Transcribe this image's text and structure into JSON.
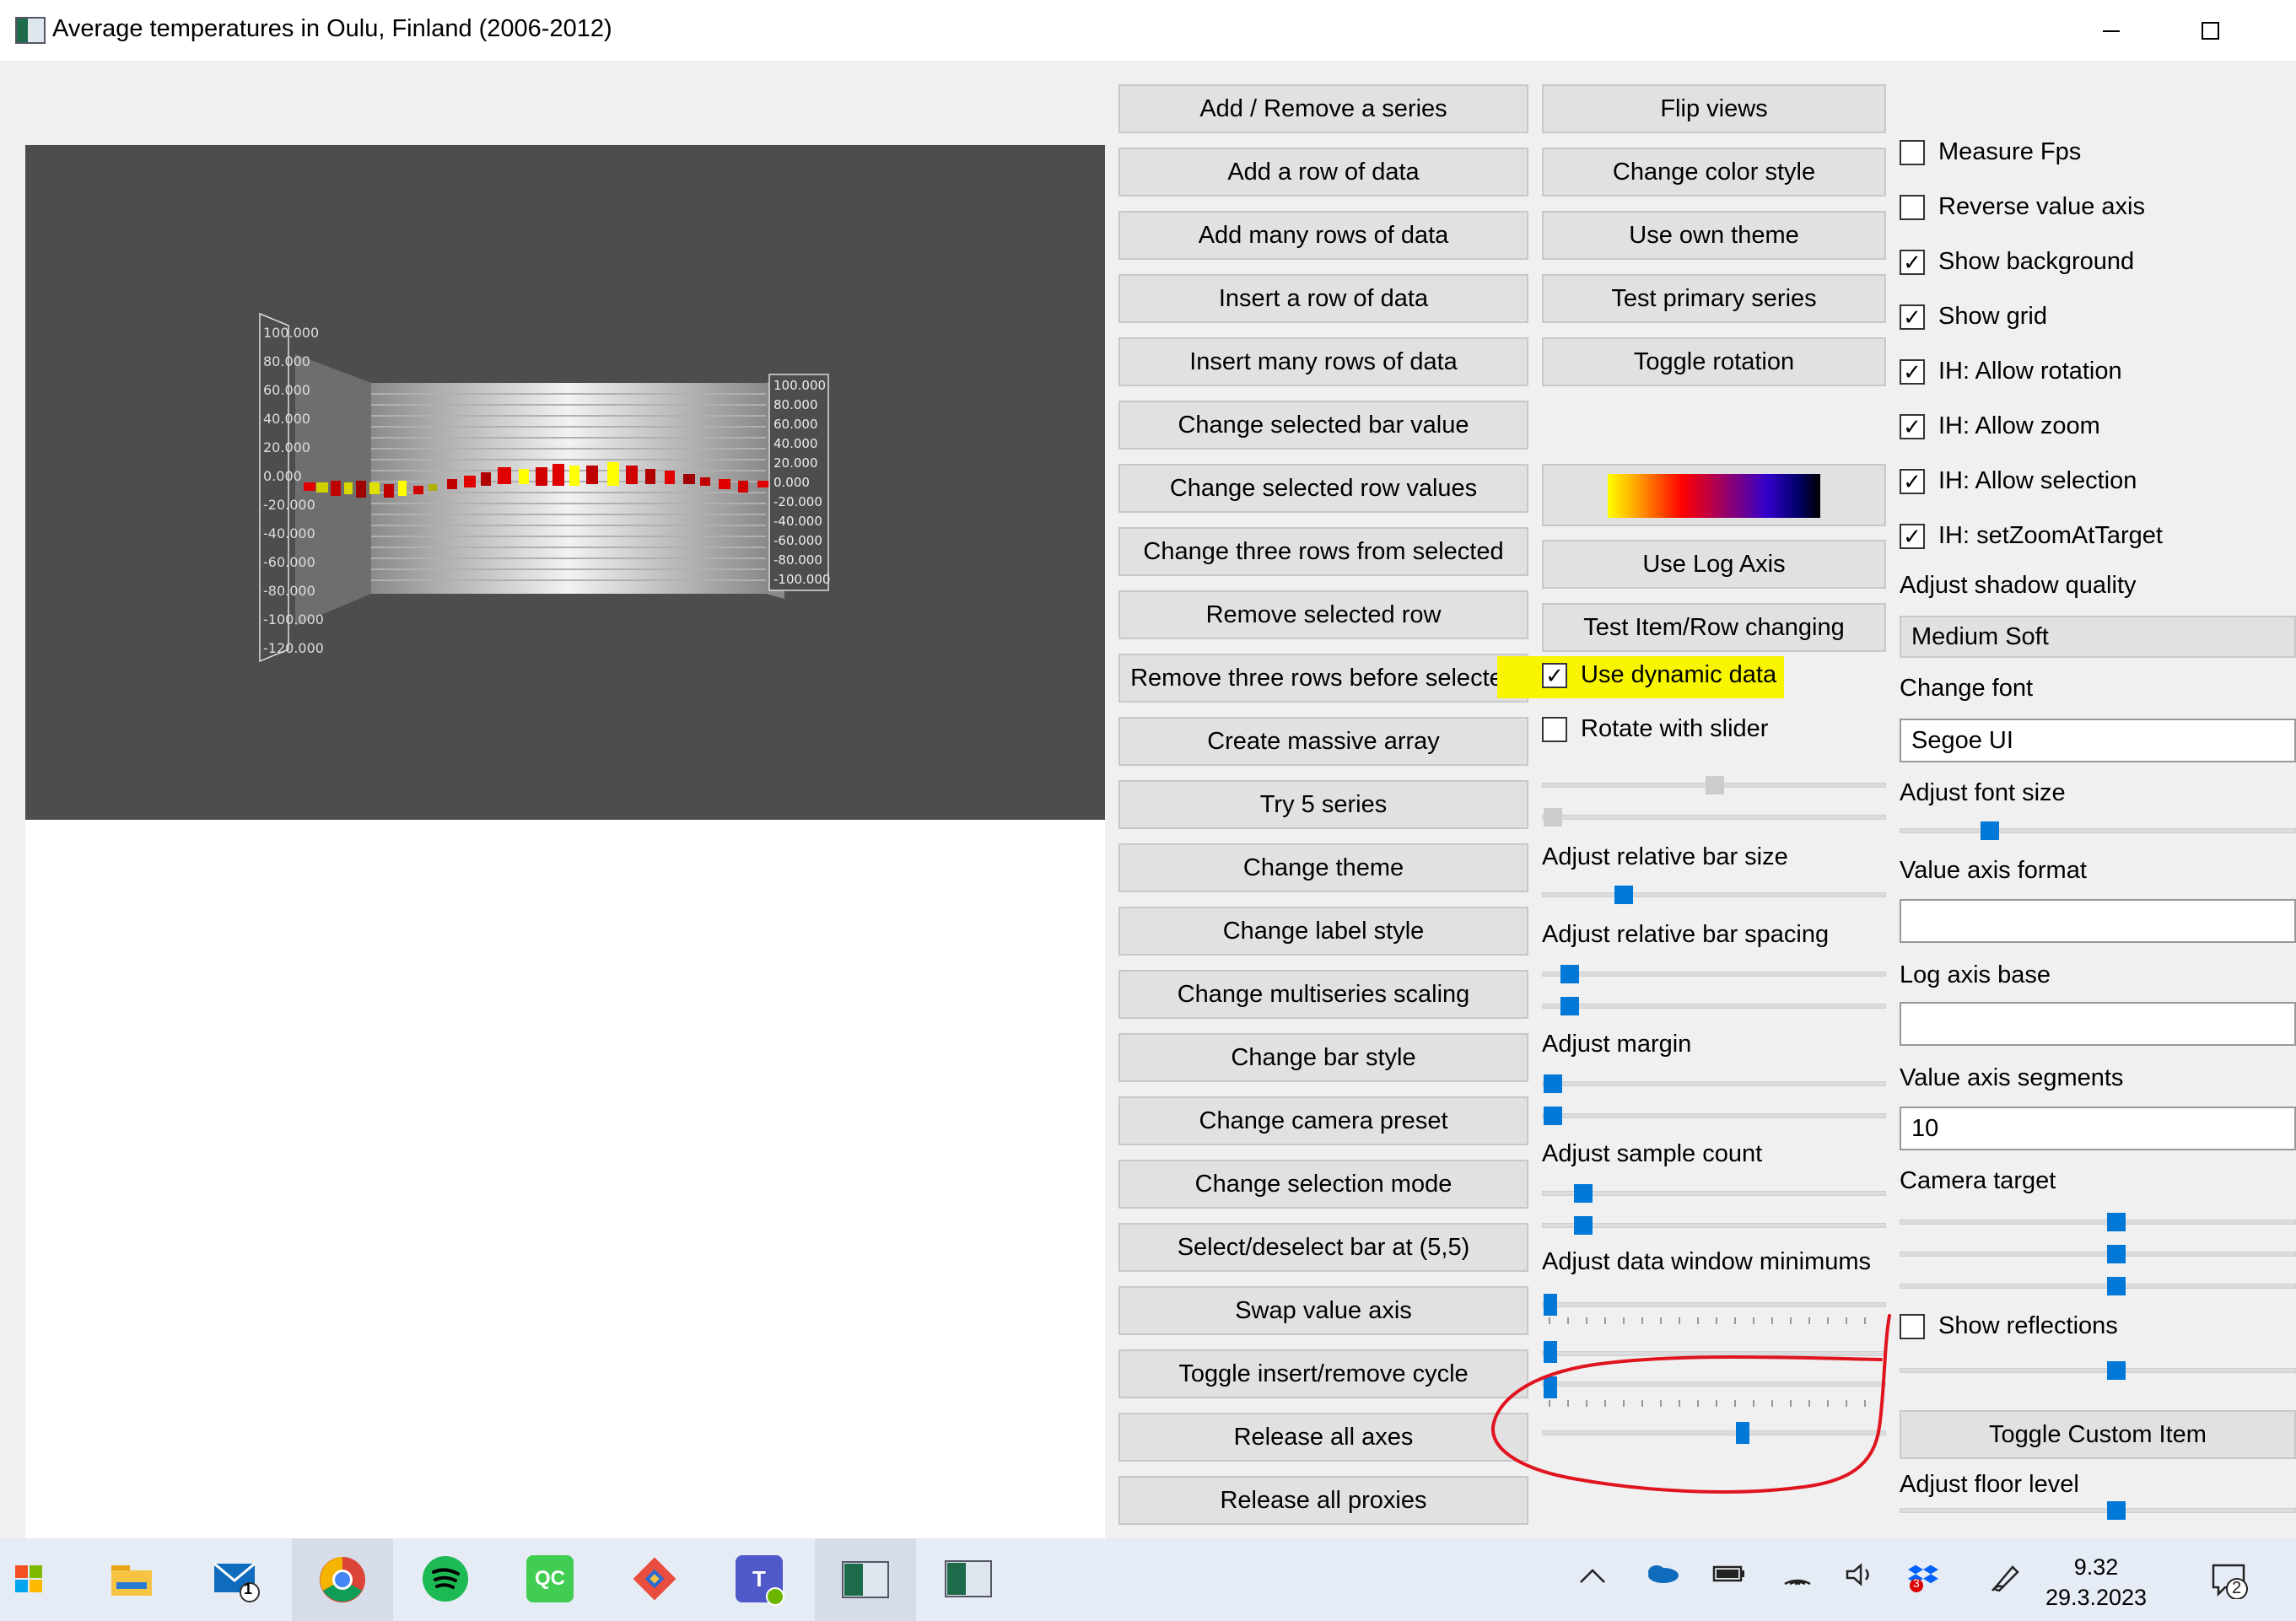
{
  "window": {
    "title": "Average temperatures in Oulu, Finland (2006-2012)"
  },
  "graph": {
    "right_axis_labels": [
      "100.000",
      "80.000",
      "60.000",
      "40.000",
      "20.000",
      "0.000",
      "-20.000",
      "-40.000",
      "-60.000",
      "-80.000",
      "-100.000"
    ],
    "left_axis_labels": [
      "100.000",
      "80.000",
      "60.000",
      "40.000",
      "20.000",
      "0.000",
      "-20.000",
      "-40.000",
      "-60.000",
      "-80.000",
      "-100.000",
      "-120.000"
    ]
  },
  "col1_buttons": [
    "Add / Remove a series",
    "Add a row of data",
    "Add many rows of data",
    "Insert a row of data",
    "Insert many rows of data",
    "Change selected bar value",
    "Change selected row values",
    "Change three rows from selected",
    "Remove selected row",
    "Remove three rows before selected",
    "Create massive array",
    "Try 5 series",
    "Change theme",
    "Change label style",
    "Change multiseries scaling",
    "Change bar style",
    "Change camera preset",
    "Change selection mode",
    "Select/deselect bar at (5,5)",
    "Swap value axis",
    "Toggle insert/remove cycle",
    "Release all axes",
    "Release all proxies"
  ],
  "col2": {
    "buttons": [
      "Flip views",
      "Change color style",
      "Use own theme",
      "Test primary series",
      "Toggle rotation"
    ],
    "use_log_axis": "Use Log Axis",
    "test_item_row": "Test Item/Row changing",
    "use_dynamic_data": "Use dynamic data",
    "use_dynamic_data_checked": true,
    "rotate_with_slider": "Rotate with slider",
    "rotate_with_slider_checked": false,
    "adjust_relative_bar_size": "Adjust relative bar size",
    "adjust_relative_bar_spacing": "Adjust relative bar spacing",
    "adjust_margin": "Adjust margin",
    "adjust_sample_count": "Adjust sample count",
    "adjust_data_window_minimums": "Adjust data window minimums"
  },
  "col3": {
    "checkboxes": [
      {
        "label": "Measure Fps",
        "checked": false
      },
      {
        "label": "Reverse value axis",
        "checked": false
      },
      {
        "label": "Show background",
        "checked": true
      },
      {
        "label": "Show grid",
        "checked": true
      },
      {
        "label": "IH: Allow rotation",
        "checked": true
      },
      {
        "label": "IH: Allow zoom",
        "checked": true
      },
      {
        "label": "IH: Allow selection",
        "checked": true
      },
      {
        "label": "IH: setZoomAtTarget",
        "checked": true
      }
    ],
    "adjust_shadow_quality": "Adjust shadow quality",
    "shadow_quality_value": "Medium Soft",
    "change_font": "Change font",
    "font_value": "Segoe UI",
    "adjust_font_size": "Adjust font size",
    "value_axis_format": "Value axis format",
    "value_axis_format_value": "",
    "log_axis_base": "Log axis base",
    "log_axis_base_value": "",
    "value_axis_segments": "Value axis segments",
    "value_axis_segments_value": "10",
    "camera_target": "Camera target",
    "show_reflections": "Show reflections",
    "show_reflections_checked": false,
    "toggle_custom_item": "Toggle Custom Item",
    "adjust_floor_level": "Adjust floor level"
  },
  "taskbar": {
    "mail_badge": "1",
    "dropbox_badge": "3",
    "time": "9.32",
    "date": "29.3.2023",
    "notification_count": "2",
    "qc_label": "QC",
    "teams_label": "T"
  },
  "colors": {
    "accent": "#0078d7",
    "highlight": "#f8f500",
    "annotation_red": "#e0141e"
  }
}
